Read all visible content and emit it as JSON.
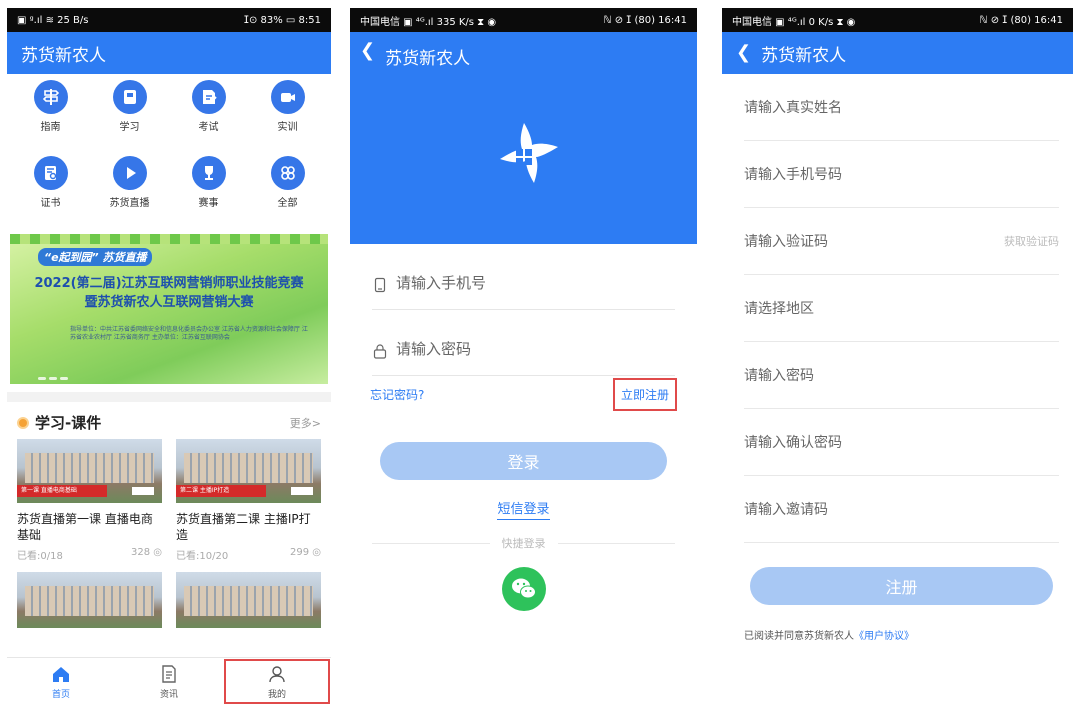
{
  "colors": {
    "brand": "#2d7cf3",
    "disabled_button": "#a8c8f4",
    "highlight_box": "#e04a4a",
    "wechat": "#2ec25b"
  },
  "screen1": {
    "status": {
      "left": "▣ ᵍ.ıl ≋ 25 B/s",
      "right": "ⵊ⊙ 83% ▭ 8:51"
    },
    "title": "苏货新农人",
    "grid": [
      {
        "label": "指南",
        "icon": "signpost-icon"
      },
      {
        "label": "学习",
        "icon": "book-icon"
      },
      {
        "label": "考试",
        "icon": "exam-icon"
      },
      {
        "label": "实训",
        "icon": "video-camera-icon"
      },
      {
        "label": "证书",
        "icon": "certificate-icon"
      },
      {
        "label": "苏货直播",
        "icon": "play-icon"
      },
      {
        "label": "赛事",
        "icon": "trophy-icon"
      },
      {
        "label": "全部",
        "icon": "all-apps-icon"
      }
    ],
    "banner": {
      "logo_left": "“e起到园” 苏货直播",
      "line1": "2022(第二届)江苏互联网营销师职业技能竞赛",
      "line2": "暨苏货新农人互联网营销大赛",
      "small": "指导单位：中共江苏省委网络安全和信息化委员会办公室  江苏省人力资源和社会保障厅  江苏省农业农村厅  江苏省商务厅  主办单位：江苏省互联网协会"
    },
    "section": {
      "title": "学习-课件",
      "more": "更多>"
    },
    "cards": [
      {
        "title": "苏货直播第一课 直播电商基础",
        "viewed": "已看:0/18",
        "views": "328",
        "stripe": "第一课 直播电商基础"
      },
      {
        "title": "苏货直播第二课 主播IP打造",
        "viewed": "已看:10/20",
        "views": "299",
        "stripe": "第二课 主播IP打造"
      }
    ],
    "tabs": [
      {
        "label": "首页"
      },
      {
        "label": "资讯"
      },
      {
        "label": "我的"
      }
    ]
  },
  "screen2": {
    "status": {
      "left": "中国电信 ▣ ⁴ᴳ.ıl 335 K/s ⧗ ◉",
      "right": "ℕ ⊘ ⵊ (80) 16:41"
    },
    "title": "苏货新农人",
    "phone_placeholder": "请输入手机号",
    "password_placeholder": "请输入密码",
    "forgot": "忘记密码?",
    "register": "立即注册",
    "login_button": "登录",
    "sms_login": "短信登录",
    "quick_login": "快捷登录"
  },
  "screen3": {
    "status": {
      "left": "中国电信 ▣ ⁴ᴳ.ıl 0 K/s ⧗ ◉",
      "right": "ℕ ⊘ ⵊ (80) 16:41"
    },
    "title": "苏货新农人",
    "fields": [
      {
        "placeholder": "请输入真实姓名"
      },
      {
        "placeholder": "请输入手机号码"
      },
      {
        "placeholder": "请输入验证码",
        "action": "获取验证码"
      },
      {
        "placeholder": "请选择地区"
      },
      {
        "placeholder": "请输入密码"
      },
      {
        "placeholder": "请输入确认密码"
      },
      {
        "placeholder": "请输入邀请码"
      }
    ],
    "register_button": "注册",
    "agree_text": "已阅读并同意苏货新农人",
    "agreement_link": "《用户协议》"
  }
}
